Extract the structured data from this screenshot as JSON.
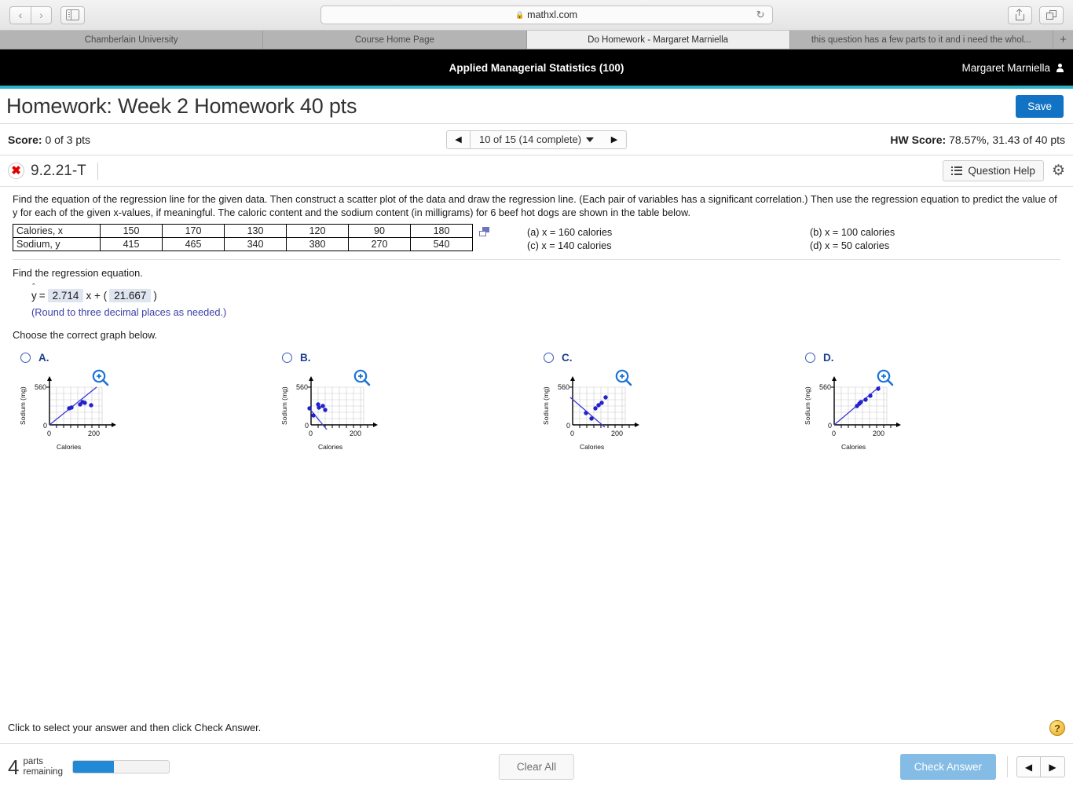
{
  "browser": {
    "url_host": "mathxl.com",
    "lock_icon": "lock-icon",
    "back_label": "‹",
    "forward_label": "›",
    "reload_label": "↻",
    "tabs": [
      {
        "label": "Chamberlain University",
        "active": false
      },
      {
        "label": "Course Home Page",
        "active": false
      },
      {
        "label": "Do Homework - Margaret Marniella",
        "active": true
      },
      {
        "label": "this question has a few parts to it and i need the whol...",
        "active": false
      }
    ],
    "new_tab_label": "+"
  },
  "app": {
    "course_title": "Applied Managerial Statistics (100)",
    "user_name": "Margaret Marniella",
    "homework_title": "Homework: Week 2 Homework 40 pts",
    "save_label": "Save",
    "score_label": "Score:",
    "score_value": "0 of 3 pts",
    "pager_text": "10 of 15 (14 complete)",
    "pager_prev": "◀",
    "pager_next": "▶",
    "hw_score_label": "HW Score:",
    "hw_score_value": "78.57%, 31.43 of 40 pts",
    "accent_teal": "#2bb3c8",
    "accent_blue": "#1273c4"
  },
  "question": {
    "status_icon": "incorrect-x-icon",
    "status_mark": "✖",
    "id": "9.2.21-T",
    "question_help_label": "Question Help",
    "settings_icon": "gear-icon",
    "prompt": "Find the equation of the regression line for the given data. Then construct a scatter plot of the data and draw the regression line. (Each pair of variables has a significant correlation.) Then use the regression equation to predict the value of y for each of the given x-values, if meaningful. The caloric content and the sodium content (in milligrams) for 6 beef hot dogs are shown in the table below.",
    "table": {
      "rows": [
        {
          "header": "Calories, x",
          "values": [
            "150",
            "170",
            "130",
            "120",
            "90",
            "180"
          ]
        },
        {
          "header": "Sodium, y",
          "values": [
            "415",
            "465",
            "340",
            "380",
            "270",
            "540"
          ]
        }
      ]
    },
    "parts": [
      "(a) x = 160 calories",
      "(b) x = 100 calories",
      "(c) x = 140 calories",
      "(d) x = 50 calories"
    ],
    "find_equation_label": "Find the regression equation.",
    "equation": {
      "yhat": "y",
      "hat_symbol": "ˆ",
      "equals": "=",
      "slope": "2.714",
      "mid": "x + (",
      "intercept": "21.667",
      "close": ")"
    },
    "round_note": "(Round to three decimal places as needed.)",
    "choose_label": "Choose the correct graph below."
  },
  "chart_data": [
    {
      "type": "scatter",
      "option": "A.",
      "title": "",
      "xlabel": "Calories",
      "ylabel": "Sodium (mg)",
      "xlim": [
        0,
        250
      ],
      "ylim": [
        0,
        650
      ],
      "xticks": [
        "0",
        "200"
      ],
      "yticks": [
        "0",
        "560"
      ],
      "grid": true,
      "x": [
        150,
        170,
        130,
        120,
        90,
        180
      ],
      "y": [
        415,
        465,
        340,
        380,
        270,
        540
      ],
      "line": {
        "slope": 2.714,
        "intercept": 21.667,
        "direction": "positive"
      },
      "point_color": "#2222cc",
      "line_color": "#3a3ad0"
    },
    {
      "type": "scatter",
      "option": "B.",
      "title": "",
      "xlabel": "Calories",
      "ylabel": "Sodium (mg)",
      "xlim": [
        0,
        250
      ],
      "ylim": [
        0,
        650
      ],
      "xticks": [
        "0",
        "200"
      ],
      "yticks": [
        "0",
        "560"
      ],
      "grid": true,
      "x": [
        15,
        45,
        55,
        70,
        30,
        20
      ],
      "y": [
        300,
        330,
        290,
        240,
        150,
        290
      ],
      "line": {
        "slope": -2.714,
        "intercept": 120,
        "direction": "negative"
      },
      "point_color": "#2222cc",
      "line_color": "#3a3ad0"
    },
    {
      "type": "scatter",
      "option": "C.",
      "title": "",
      "xlabel": "Calories",
      "ylabel": "Sodium (mg)",
      "xlim": [
        0,
        250
      ],
      "ylim": [
        0,
        650
      ],
      "xticks": [
        "0",
        "200"
      ],
      "yticks": [
        "0",
        "560"
      ],
      "grid": true,
      "x": [
        70,
        90,
        105,
        115,
        130,
        145
      ],
      "y": [
        190,
        120,
        250,
        290,
        330,
        410
      ],
      "line": {
        "slope": -2.714,
        "intercept": 430,
        "direction": "negative"
      },
      "point_color": "#2222cc",
      "line_color": "#3a3ad0"
    },
    {
      "type": "scatter",
      "option": "D.",
      "title": "",
      "xlabel": "Calories",
      "ylabel": "Sodium (mg)",
      "xlim": [
        0,
        250
      ],
      "ylim": [
        0,
        650
      ],
      "xticks": [
        "0",
        "200"
      ],
      "yticks": [
        "0",
        "560"
      ],
      "grid": true,
      "x": [
        100,
        120,
        128,
        140,
        160,
        185
      ],
      "y": [
        290,
        355,
        375,
        420,
        470,
        550
      ],
      "line": {
        "slope": 2.95,
        "intercept": 0,
        "direction": "positive"
      },
      "point_color": "#2222cc",
      "line_color": "#3a3ad0"
    }
  ],
  "footer": {
    "instruction": "Click to select your answer and then click Check Answer.",
    "help_icon": "question-mark-icon",
    "help_label": "?",
    "parts_number": "4",
    "parts_label_line1": "parts",
    "parts_label_line2": "remaining",
    "progress_percent": 43,
    "clear_all_label": "Clear All",
    "check_answer_label": "Check Answer",
    "prev_label": "◀",
    "next_label": "▶"
  }
}
